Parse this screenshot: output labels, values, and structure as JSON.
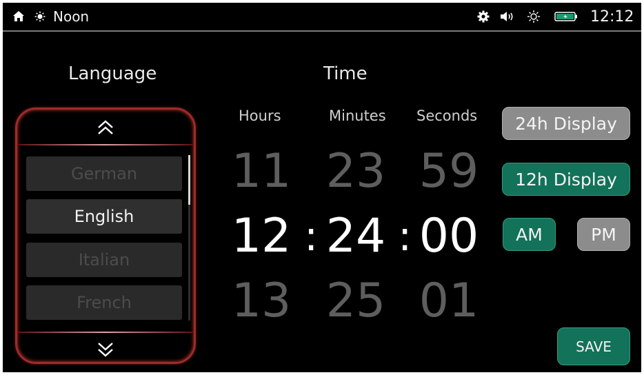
{
  "status_bar": {
    "daypart": "Noon",
    "clock": "12:12"
  },
  "language": {
    "title": "Language",
    "items": [
      {
        "label": "German",
        "selected": false
      },
      {
        "label": "English",
        "selected": true
      },
      {
        "label": "Italian",
        "selected": false
      },
      {
        "label": "French",
        "selected": false
      }
    ]
  },
  "time": {
    "title": "Time",
    "columns": {
      "hours": "Hours",
      "minutes": "Minutes",
      "seconds": "Seconds"
    },
    "previous": {
      "hours": "11",
      "minutes": "23",
      "seconds": "59"
    },
    "current": {
      "hours": "12",
      "minutes": "24",
      "seconds": "00"
    },
    "next": {
      "hours": "13",
      "minutes": "25",
      "seconds": "01"
    },
    "separator": ":"
  },
  "buttons": {
    "display_24h": "24h Display",
    "display_12h": "12h Display",
    "am": "AM",
    "pm": "PM",
    "save": "SAVE"
  },
  "colors": {
    "active": "#12725a",
    "inactive": "#8c8c8c",
    "panel_border": "#a02a2a"
  }
}
